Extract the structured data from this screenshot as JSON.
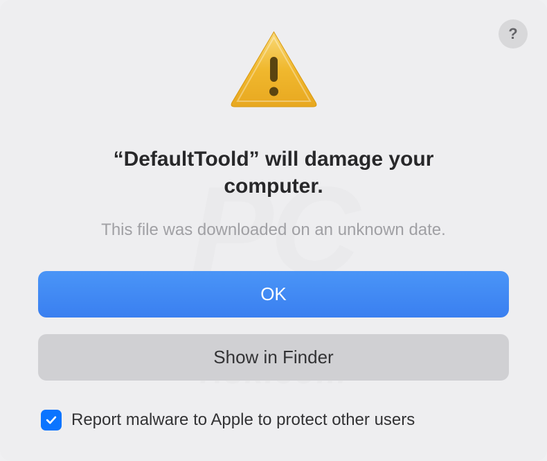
{
  "dialog": {
    "help_label": "?",
    "title": "“DefaultToold” will damage your computer.",
    "subtitle": "This file was downloaded on an unknown date.",
    "primary_button": "OK",
    "secondary_button": "Show in Finder",
    "checkbox_checked": true,
    "checkbox_label": "Report malware to Apple to protect other users"
  },
  "icons": {
    "warning": "warning-triangle",
    "help": "question-mark",
    "check": "checkmark"
  },
  "colors": {
    "primary_button": "#3a7ff0",
    "secondary_button": "#d0d0d3",
    "checkbox": "#0b74ff",
    "warning_fill": "#f0b82e"
  }
}
